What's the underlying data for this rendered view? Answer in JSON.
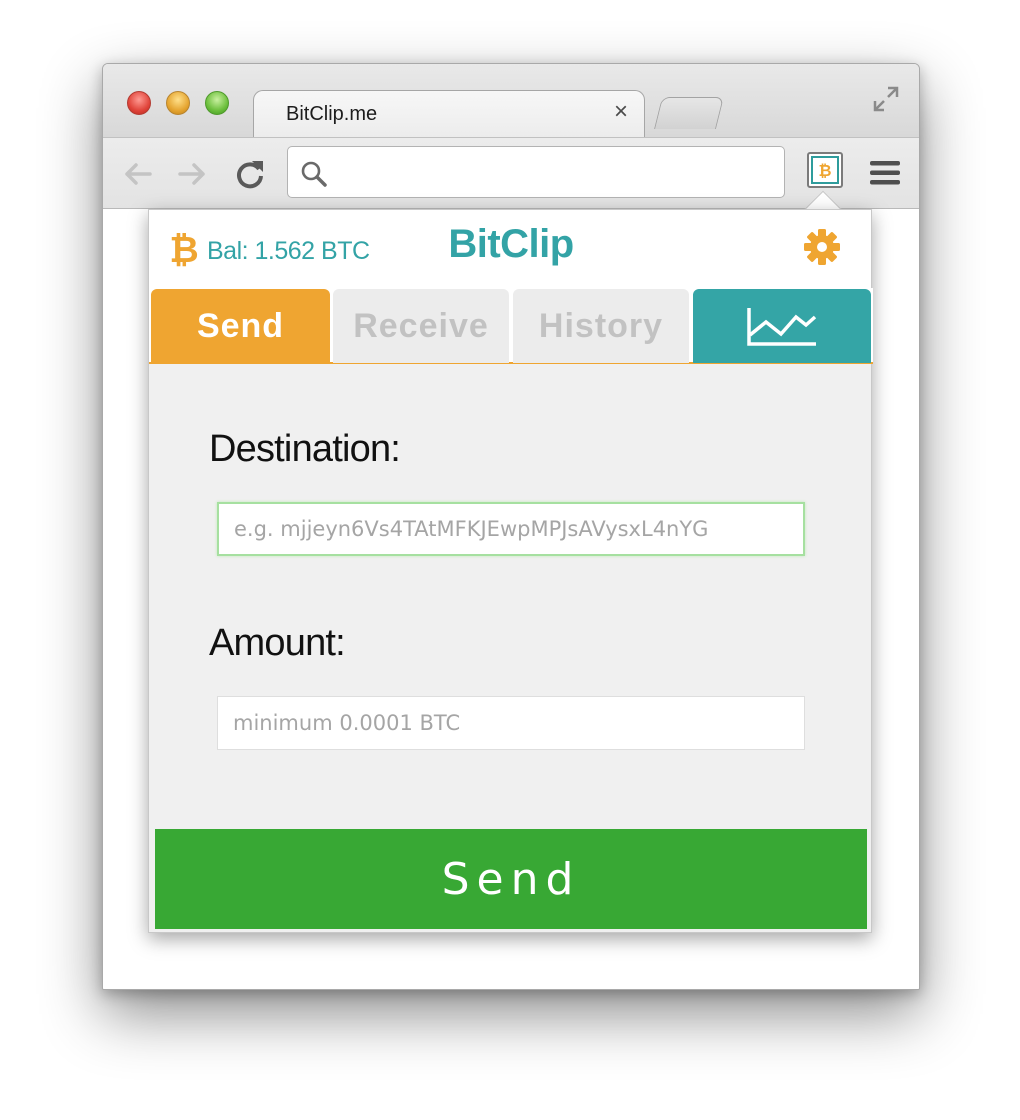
{
  "browser": {
    "tab_title": "BitClip.me",
    "tab_close_glyph": "×",
    "address_value": "",
    "icons": [
      "close-window-icon",
      "minimize-window-icon",
      "zoom-window-icon",
      "fullscreen-icon",
      "back-arrow-icon",
      "forward-arrow-icon",
      "reload-icon",
      "search-icon",
      "bitcoin-extension-icon",
      "hamburger-menu-icon"
    ]
  },
  "popup": {
    "balance": "Bal: 1.562 BTC",
    "brand": "BitClip",
    "tabs": [
      {
        "label": "Send",
        "active": true
      },
      {
        "label": "Receive",
        "active": false
      },
      {
        "label": "History",
        "active": false
      },
      {
        "label": "",
        "icon": "line-chart-icon",
        "active": false
      }
    ],
    "destination_label": "Destination:",
    "destination_placeholder": "e.g. mjjeyn6Vs4TAtMFKJEwpMPJsAVysxL4nYG",
    "amount_label": "Amount:",
    "amount_placeholder": "minimum 0.0001 BTC",
    "send_button": "Send"
  },
  "colors": {
    "accent_teal": "#33a3a6",
    "accent_orange": "#efa531",
    "send_green": "#38a834"
  }
}
